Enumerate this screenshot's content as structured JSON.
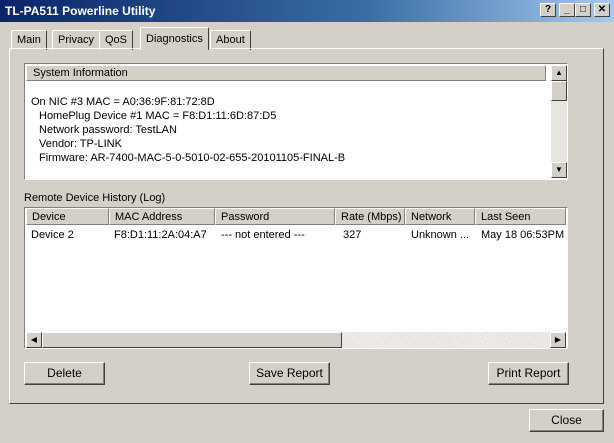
{
  "window": {
    "title": "TL-PA511 Powerline Utility",
    "controls": {
      "help": "?",
      "minimize": "_",
      "maximize": "□",
      "close": "✕"
    }
  },
  "tabs": [
    {
      "label": "Main"
    },
    {
      "label": "Privacy"
    },
    {
      "label": "QoS"
    },
    {
      "label": "Diagnostics",
      "active": true
    },
    {
      "label": "About"
    }
  ],
  "system_info": {
    "header": "System Information",
    "lines": [
      "On NIC #3 MAC = A0:36:9F:81:72:8D",
      "HomePlug Device #1 MAC = F8:D1:11:6D:87:D5",
      "Network password: TestLAN",
      "Vendor: TP-LINK",
      "Firmware: AR-7400-MAC-5-0-5010-02-655-20101105-FINAL-B"
    ]
  },
  "log": {
    "label": "Remote Device History (Log)",
    "columns": [
      "Device",
      "MAC Address",
      "Password",
      "Rate (Mbps)",
      "Network",
      "Last Seen"
    ],
    "rows": [
      [
        "Device 2",
        "F8:D1:11:2A:04:A7",
        "--- not entered ---",
        "327",
        "Unknown ...",
        "May 18 06:53PM"
      ]
    ]
  },
  "buttons": {
    "delete": "Delete",
    "save_report": "Save Report",
    "print_report": "Print Report",
    "close": "Close"
  },
  "icons": {
    "scroll_up": "▲",
    "scroll_down": "▼",
    "scroll_left": "◀",
    "scroll_right": "▶"
  }
}
